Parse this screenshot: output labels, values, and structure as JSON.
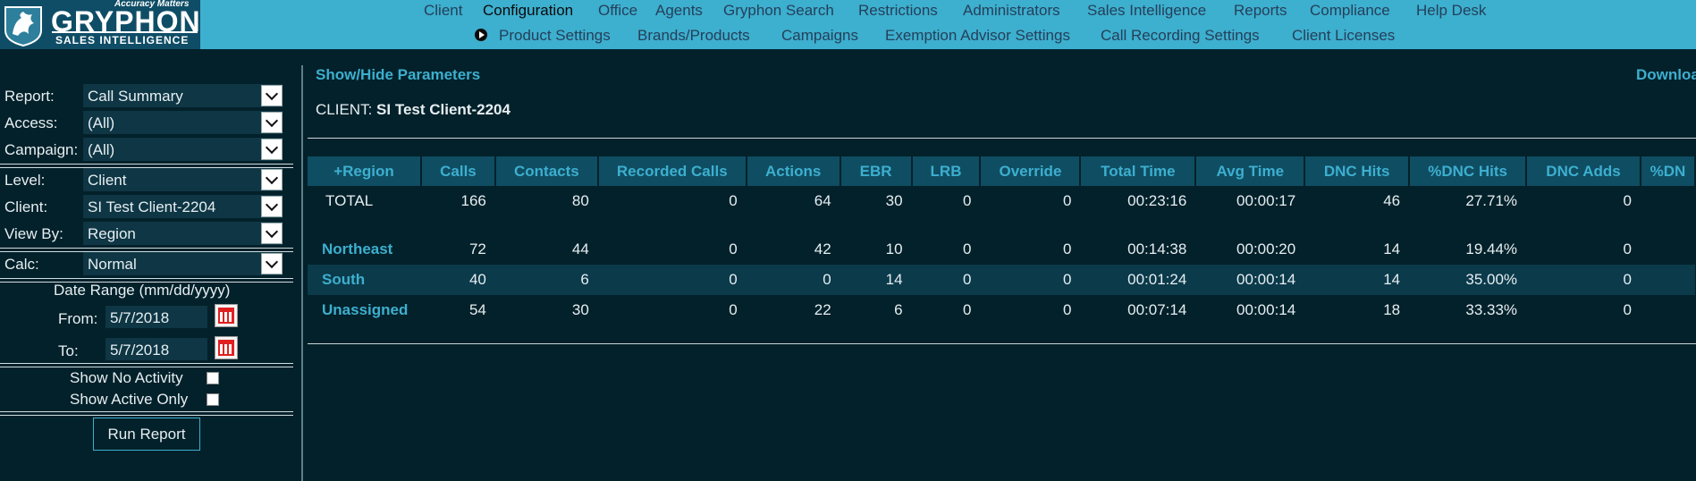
{
  "brand": {
    "tagline": "Accuracy Matters",
    "name": "GRYPHON",
    "subtitle": "SALES INTELLIGENCE"
  },
  "nav": {
    "items": [
      "Client",
      "Configuration",
      "Office",
      "Agents",
      "Gryphon Search",
      "Restrictions",
      "Administrators",
      "Sales Intelligence",
      "Reports",
      "Compliance",
      "Help Desk"
    ],
    "active": "Configuration",
    "subitems": [
      "Product Settings",
      "Brands/Products",
      "Campaigns",
      "Exemption Advisor Settings",
      "Call Recording Settings",
      "Client Licenses"
    ]
  },
  "params": {
    "report": {
      "label": "Report:",
      "value": "Call Summary"
    },
    "access": {
      "label": "Access:",
      "value": "(All)"
    },
    "campaign": {
      "label": "Campaign:",
      "value": "(All)"
    },
    "level": {
      "label": "Level:",
      "value": "Client"
    },
    "client": {
      "label": "Client:",
      "value": "SI Test Client-2204"
    },
    "view_by": {
      "label": "View By:",
      "value": "Region"
    },
    "calc": {
      "label": "Calc:",
      "value": "Normal"
    },
    "date_range_heading": "Date Range  (mm/dd/yyyy)",
    "from": {
      "label": "From:",
      "value": "5/7/2018"
    },
    "to": {
      "label": "To:",
      "value": "5/7/2018"
    },
    "show_no_activity": {
      "label": "Show No Activity",
      "checked": false
    },
    "show_active_only": {
      "label": "Show Active Only",
      "checked": false
    },
    "run_button": "Run Report"
  },
  "main": {
    "show_hide_label": "Show/Hide Parameters",
    "download_label": "Downloa",
    "client_prefix": "CLIENT:",
    "client_name": "SI Test Client-2204",
    "columns": [
      "+Region",
      "Calls",
      "Contacts",
      "Recorded Calls",
      "Actions",
      "EBR",
      "LRB",
      "Override",
      "Total Time",
      "Avg Time",
      "DNC Hits",
      "%DNC Hits",
      "DNC Adds",
      "%DN"
    ],
    "total_row": [
      "TOTAL",
      "166",
      "80",
      "0",
      "64",
      "30",
      "0",
      "0",
      "00:23:16",
      "00:00:17",
      "46",
      "27.71%",
      "0",
      ""
    ],
    "rows": [
      [
        "Northeast",
        "72",
        "44",
        "0",
        "42",
        "10",
        "0",
        "0",
        "00:14:38",
        "00:00:20",
        "14",
        "19.44%",
        "0",
        ""
      ],
      [
        "South",
        "40",
        "6",
        "0",
        "0",
        "14",
        "0",
        "0",
        "00:01:24",
        "00:00:14",
        "14",
        "35.00%",
        "0",
        ""
      ],
      [
        "Unassigned",
        "54",
        "30",
        "0",
        "22",
        "6",
        "0",
        "0",
        "00:07:14",
        "00:00:14",
        "18",
        "33.33%",
        "0",
        ""
      ]
    ]
  }
}
